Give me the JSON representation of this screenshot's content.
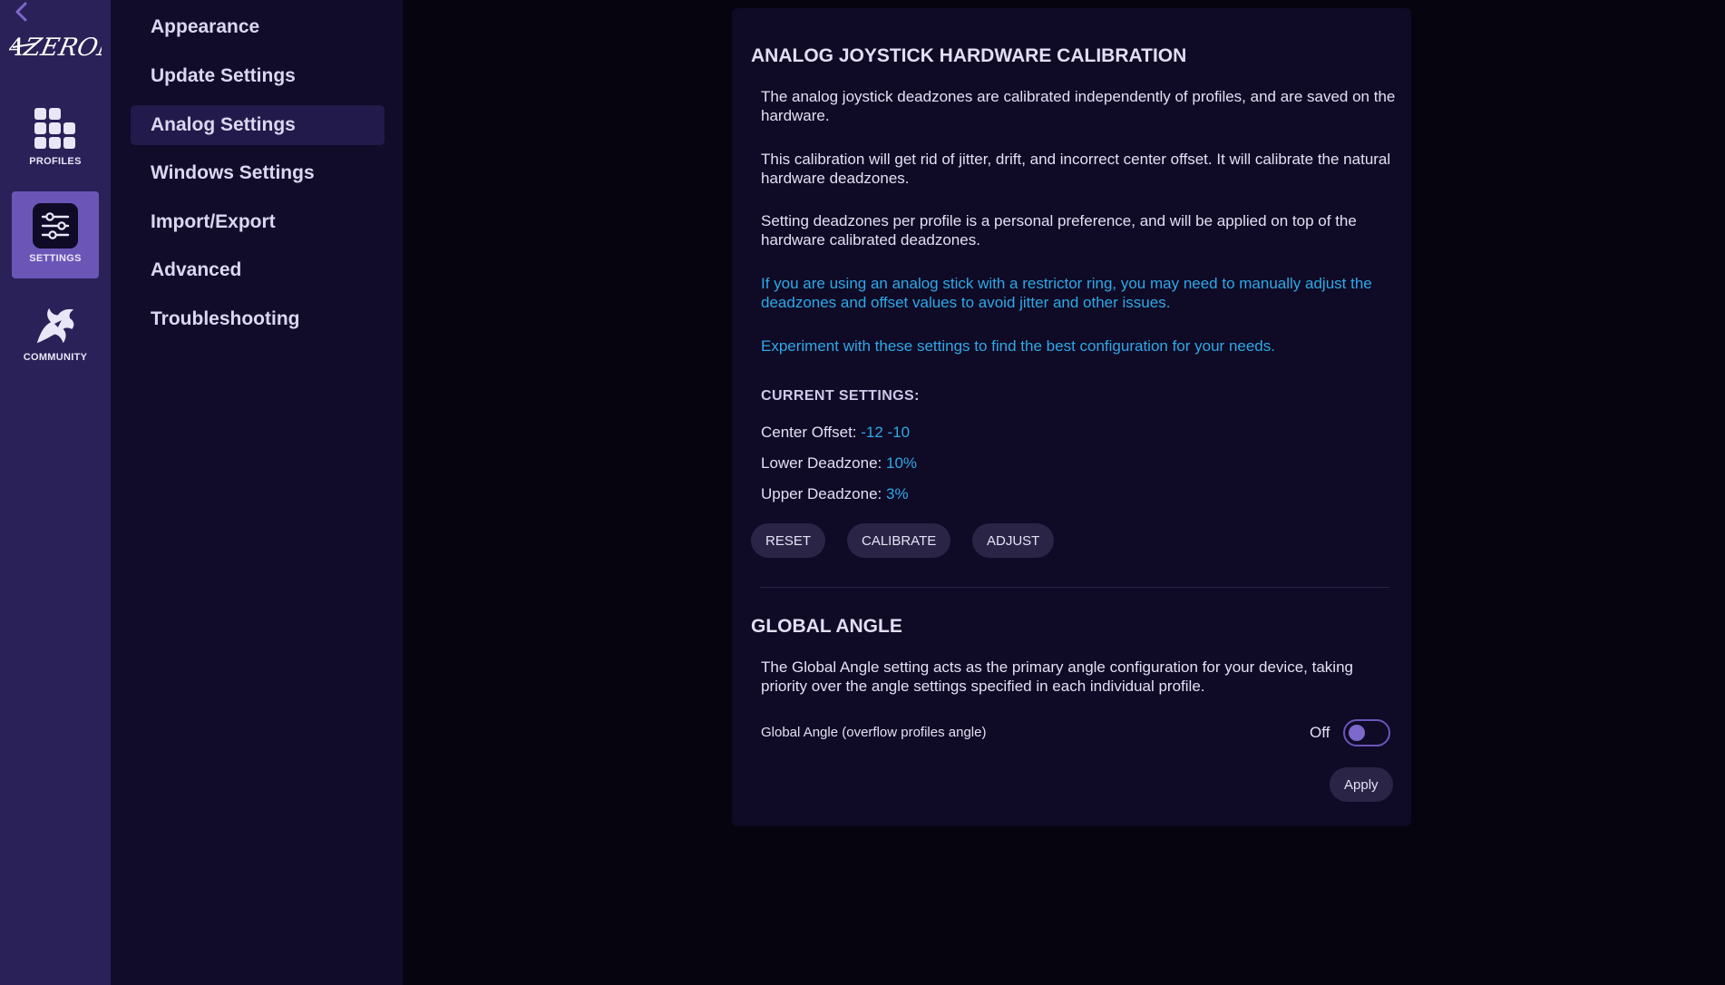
{
  "rail": {
    "logo_text": "AZERON",
    "items": [
      {
        "label": "PROFILES",
        "icon": "grid-icon"
      },
      {
        "label": "SETTINGS",
        "icon": "sliders-icon"
      },
      {
        "label": "COMMUNITY",
        "icon": "dragon-icon"
      }
    ],
    "active_index": 1
  },
  "nav": {
    "items": [
      {
        "label": "Appearance"
      },
      {
        "label": "Update Settings"
      },
      {
        "label": "Analog Settings"
      },
      {
        "label": "Windows Settings"
      },
      {
        "label": "Import/Export"
      },
      {
        "label": "Advanced"
      },
      {
        "label": "Troubleshooting"
      }
    ],
    "active_index": 2
  },
  "calibration": {
    "title": "ANALOG JOYSTICK HARDWARE CALIBRATION",
    "para1": "The analog joystick deadzones are calibrated independently of profiles, and are saved on the hardware.",
    "para2": "This calibration will get rid of jitter, drift, and incorrect center offset. It will calibrate the natural hardware deadzones.",
    "para3": "Setting deadzones per profile is a personal preference, and will be applied on top of the hardware calibrated deadzones.",
    "note1": "If you are using an analog stick with a restrictor ring, you may need to manually adjust the deadzones and offset values to avoid jitter and other issues.",
    "note2": "Experiment with these settings to find the best configuration for your needs.",
    "current_heading": "CURRENT SETTINGS:",
    "center_offset_label": "Center Offset: ",
    "center_offset_value": "-12 -10",
    "lower_deadzone_label": "Lower Deadzone: ",
    "lower_deadzone_value": "10%",
    "upper_deadzone_label": "Upper Deadzone: ",
    "upper_deadzone_value": "3%",
    "reset_label": "RESET",
    "calibrate_label": "CALIBRATE",
    "adjust_label": "ADJUST"
  },
  "global_angle": {
    "title": "GLOBAL ANGLE",
    "description": "The Global Angle setting acts as the primary angle configuration for your device, taking priority over the angle settings specified in each individual profile.",
    "toggle_label": "Global Angle (overflow profiles angle)",
    "toggle_state": "Off",
    "apply_label": "Apply"
  },
  "colors": {
    "accent_blue": "#2ea9e6",
    "brand_purple": "#6b56b8",
    "rail_bg": "#2a2158",
    "nav_bg": "#110c2a",
    "card_bg": "#0f0a26",
    "page_bg": "#06040f"
  }
}
